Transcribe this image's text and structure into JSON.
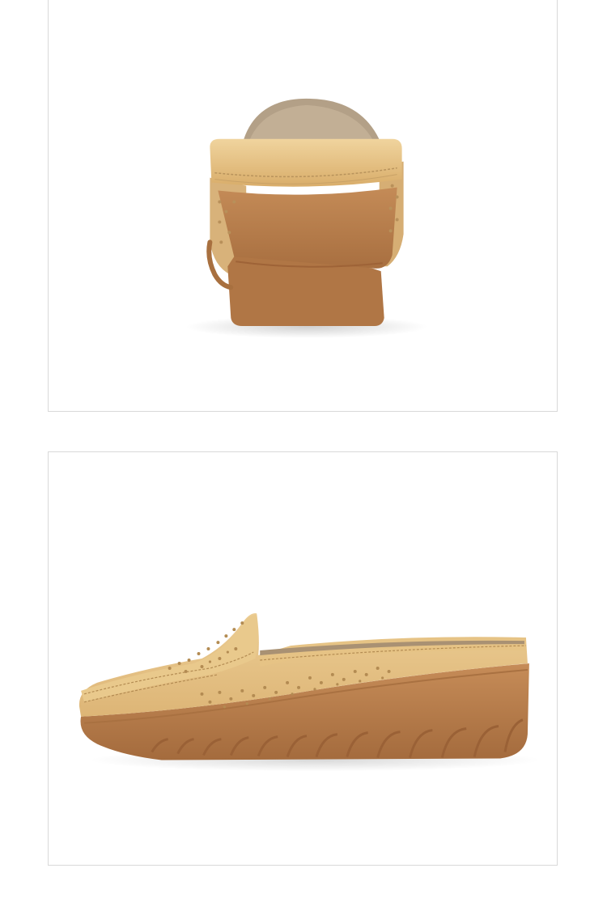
{
  "images": [
    {
      "view": "back",
      "subject": "slip-on-wedge-shoe"
    },
    {
      "view": "side",
      "subject": "slip-on-wedge-shoe"
    }
  ],
  "colors": {
    "background": "#ffffff",
    "frame_border": "#d9d9d9",
    "leather": "#e3bd7c",
    "leather_light": "#eed39d",
    "leather_dark": "#c99a55",
    "sole": "#b77e4e",
    "sole_dark": "#9c6538",
    "insole": "#b7a48a"
  }
}
